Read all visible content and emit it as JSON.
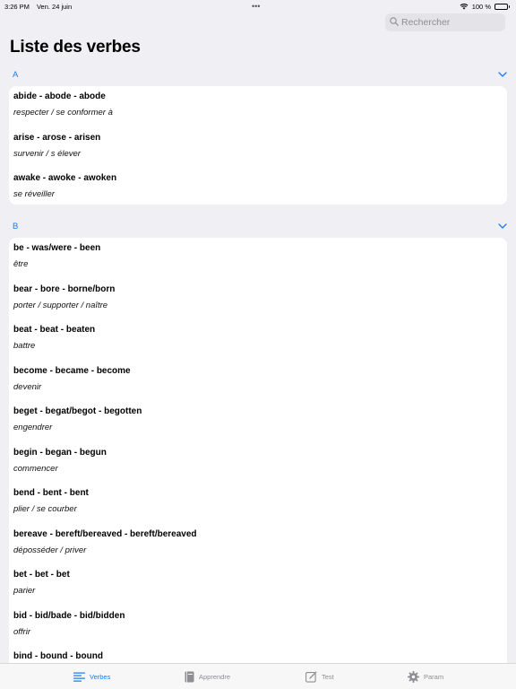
{
  "status": {
    "time": "3:26 PM",
    "date": "Ven. 24 juin",
    "dots": "•••",
    "battery": "100 %"
  },
  "search": {
    "placeholder": "Rechercher"
  },
  "page_title": "Liste des verbes",
  "sections": [
    {
      "letter": "A",
      "verbs": [
        {
          "forms": "abide - abode - abode",
          "translation": "respecter / se conformer à"
        },
        {
          "forms": "arise - arose - arisen",
          "translation": "survenir / s élever"
        },
        {
          "forms": "awake - awoke - awoken",
          "translation": "se réveiller"
        }
      ]
    },
    {
      "letter": "B",
      "verbs": [
        {
          "forms": "be - was/were - been",
          "translation": "être"
        },
        {
          "forms": "bear - bore - borne/born",
          "translation": "porter / supporter / naître"
        },
        {
          "forms": "beat - beat - beaten",
          "translation": "battre"
        },
        {
          "forms": "become - became - become",
          "translation": "devenir"
        },
        {
          "forms": "beget - begat/begot - begotten",
          "translation": "engendrer"
        },
        {
          "forms": "begin - began - begun",
          "translation": "commencer"
        },
        {
          "forms": "bend - bent - bent",
          "translation": "plier / se courber"
        },
        {
          "forms": "bereave - bereft/bereaved - bereft/bereaved",
          "translation": "déposséder / priver"
        },
        {
          "forms": "bet - bet - bet",
          "translation": "parier"
        },
        {
          "forms": "bid - bid/bade - bid/bidden",
          "translation": "offrir"
        },
        {
          "forms": "bind - bound - bound",
          "translation": ""
        }
      ]
    }
  ],
  "tabs": [
    {
      "label": "Verbes",
      "icon": "list-icon",
      "active": true
    },
    {
      "label": "Apprendre",
      "icon": "book-icon",
      "active": false
    },
    {
      "label": "Test",
      "icon": "edit-icon",
      "active": false
    },
    {
      "label": "Param",
      "icon": "gear-icon",
      "active": false
    }
  ],
  "colors": {
    "accent": "#1a7cf3",
    "background": "#efeff4",
    "inactive": "#8e8e93"
  }
}
